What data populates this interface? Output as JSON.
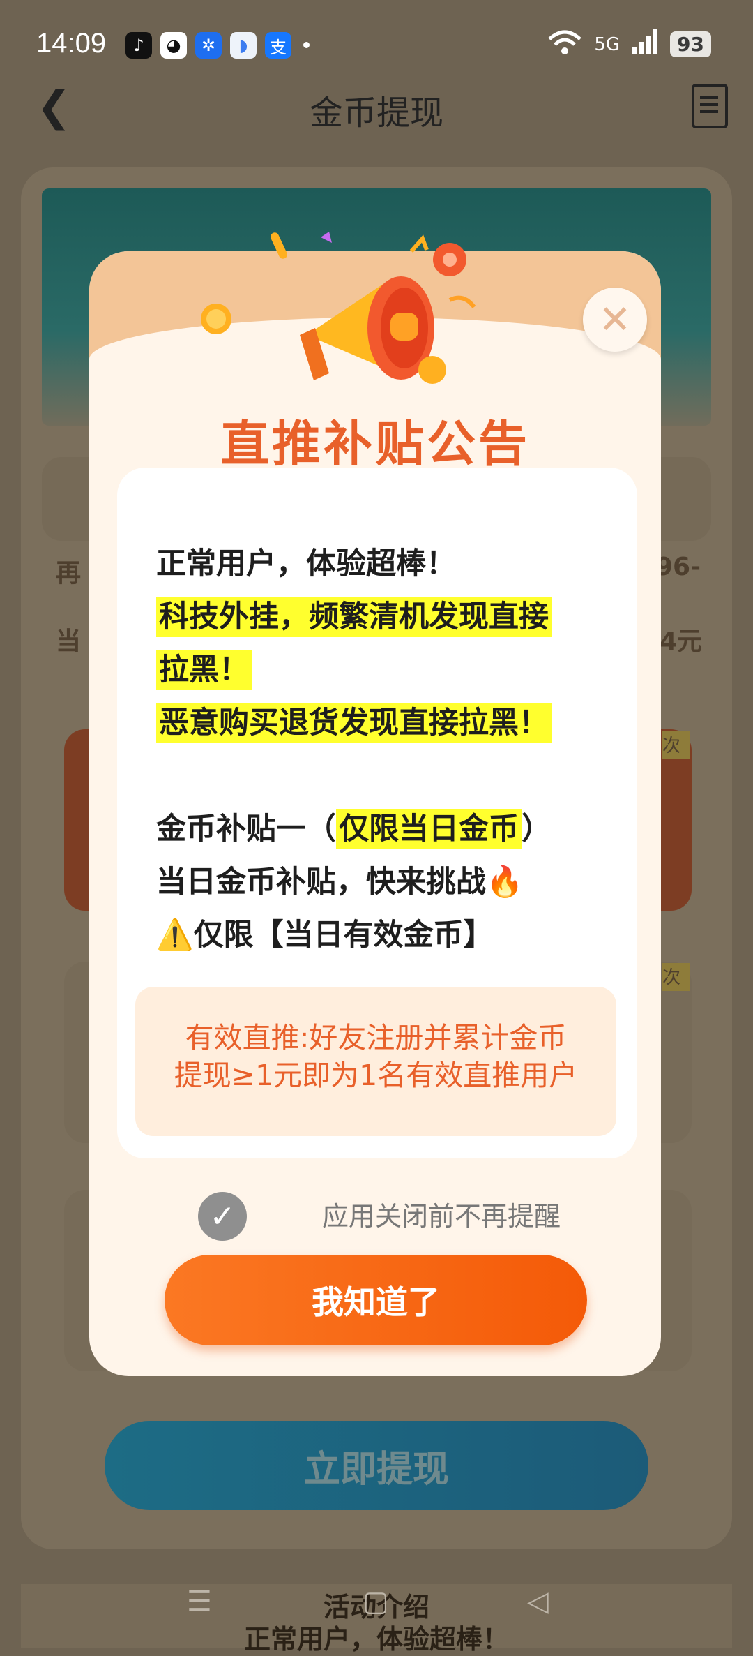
{
  "status_bar": {
    "time": "14:09",
    "network": "5G",
    "battery": "93"
  },
  "header": {
    "title": "金币提现"
  },
  "background": {
    "left_text_1": "再",
    "right_text_1": "96-",
    "left_text_2": "当",
    "right_text_2": "4元",
    "tag_1": "次",
    "tag_2": "次",
    "withdraw_button": "立即提现",
    "section_title": "活动介绍",
    "section_line": "正常用户，体验超棒！"
  },
  "modal": {
    "headline": "直推补贴公告",
    "line_1": "正常用户，体验超棒！",
    "line_2": "科技外挂，频繁清机发现直接",
    "line_3": "拉黑！",
    "line_4": "恶意购买退货发现直接拉黑！",
    "line_5_prefix": "金币补贴一（",
    "line_5_highlight": "仅限当日金币",
    "line_5_suffix": "）",
    "line_6": "当日金币补贴，快来挑战",
    "line_6_emoji": "🔥",
    "line_7_icon": "⚠️",
    "line_7": "仅限【当日有效金币】",
    "notice_1": "有效直推:好友注册并累计金币",
    "notice_2": "提现≥1元即为1名有效直推用户",
    "dont_remind": "应用关闭前不再提醒",
    "confirm_button": "我知道了"
  },
  "colors": {
    "accent": "#f45a08",
    "headline": "#e8602a",
    "highlight": "#ffff2e"
  }
}
